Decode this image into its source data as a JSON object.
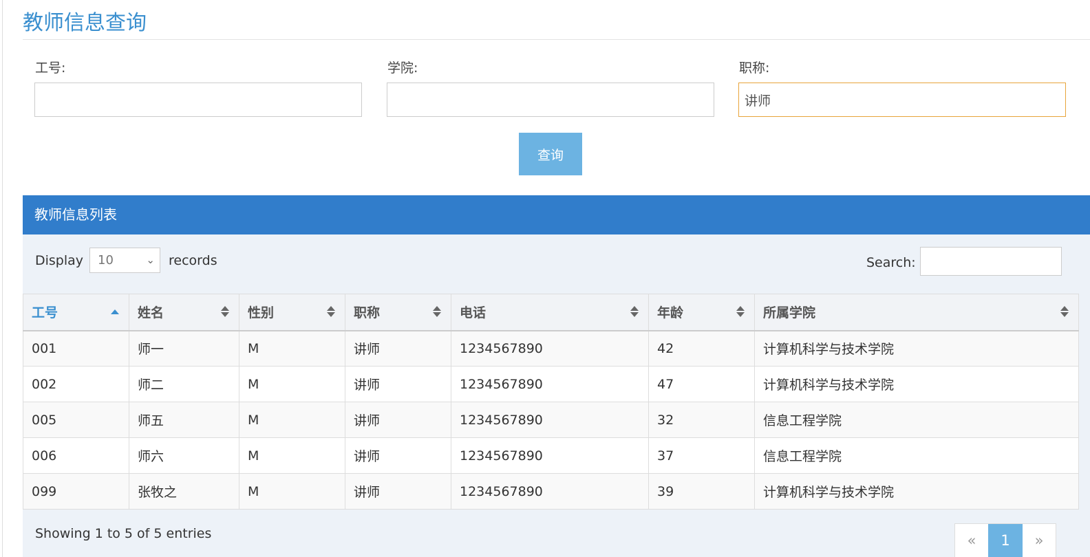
{
  "page": {
    "title": "教师信息查询"
  },
  "filters": {
    "id_label": "工号:",
    "id_value": "",
    "college_label": "学院:",
    "college_value": "",
    "rank_label": "职称:",
    "rank_value": "讲师",
    "query_button": "查询"
  },
  "panel": {
    "title": "教师信息列表"
  },
  "table_controls": {
    "display_label": "Display",
    "page_size": "10",
    "records_label": "records",
    "search_label": "Search:",
    "search_value": ""
  },
  "table": {
    "columns": [
      "工号",
      "姓名",
      "性别",
      "职称",
      "电话",
      "年龄",
      "所属学院"
    ],
    "rows": [
      [
        "001",
        "师一",
        "M",
        "讲师",
        "1234567890",
        "42",
        "计算机科学与技术学院"
      ],
      [
        "002",
        "师二",
        "M",
        "讲师",
        "1234567890",
        "47",
        "计算机科学与技术学院"
      ],
      [
        "005",
        "师五",
        "M",
        "讲师",
        "1234567890",
        "32",
        "信息工程学院"
      ],
      [
        "006",
        "师六",
        "M",
        "讲师",
        "1234567890",
        "37",
        "信息工程学院"
      ],
      [
        "099",
        "张牧之",
        "M",
        "讲师",
        "1234567890",
        "39",
        "计算机科学与技术学院"
      ]
    ]
  },
  "footer": {
    "info": "Showing 1 to 5 of 5 entries",
    "prev": "«",
    "current_page": "1",
    "next": "»"
  },
  "colors": {
    "accent": "#3a8fcf",
    "panel_header": "#317dcb",
    "button": "#6cb3e2",
    "focus_border": "#e8a43a"
  }
}
